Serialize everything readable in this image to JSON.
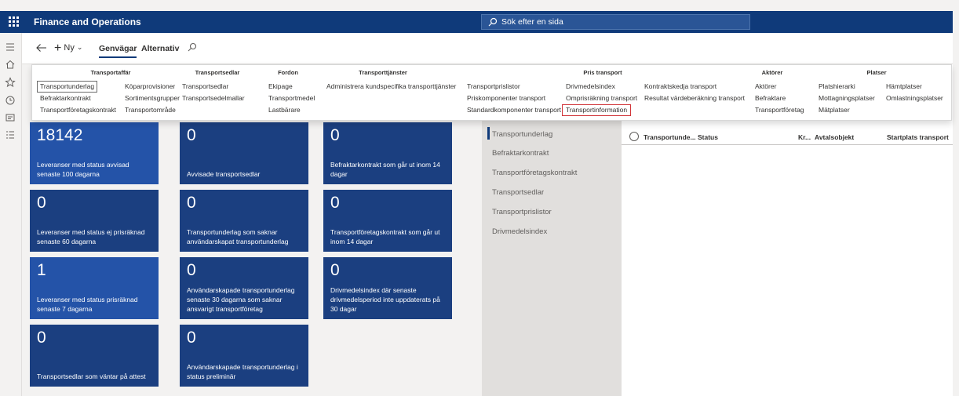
{
  "app": {
    "title": "Finance and Operations"
  },
  "search": {
    "placeholder": "Sök efter en sida"
  },
  "action_pane": {
    "new_label": "Ny",
    "tabs": [
      "Genvägar",
      "Alternativ"
    ]
  },
  "flyout": {
    "groups": {
      "transportaffar": {
        "header": "Transportaffär",
        "col1": [
          "Transportunderlag",
          "Befraktarkontrakt",
          "Transportföretagskontrakt"
        ],
        "col2": [
          "Köparprovisioner",
          "Sortimentsgrupper",
          "Transportområde"
        ]
      },
      "transportsedlar": {
        "header": "Transportsedlar",
        "items": [
          "Transportsedlar",
          "Transportsedelmallar"
        ]
      },
      "fordon": {
        "header": "Fordon",
        "items": [
          "Ekipage",
          "Transportmedel",
          "Lastbärare"
        ]
      },
      "transporttjanster": {
        "header": "Transporttjänster",
        "items": [
          "Administrera kundspecifika transporttjänster"
        ]
      },
      "pris_transport": {
        "header": "Pris transport",
        "col1": [
          "Transportprislistor",
          "Priskomponenter transport",
          "Standardkomponenter transport"
        ],
        "col2": [
          "Drivmedelsindex",
          "Omprisräkning transport",
          "Transportinformation"
        ],
        "col3": [
          "Kontraktskedja transport",
          "Resultat värdeberäkning transport"
        ]
      },
      "aktorer": {
        "header": "Aktörer",
        "items": [
          "Aktörer",
          "Befraktare",
          "Transportföretag"
        ]
      },
      "platser": {
        "header": "Platser",
        "col1": [
          "Platshierarki",
          "Mottagningsplatser",
          "Mätplatser"
        ],
        "col2": [
          "Hämtplatser",
          "Omlastningsplatser"
        ]
      }
    }
  },
  "tiles": [
    {
      "value": "18142",
      "label": "Leveranser med status avvisad senaste 100 dagarna"
    },
    {
      "value": "0",
      "label": "Avvisade transportsedlar"
    },
    {
      "value": "0",
      "label": "Befraktarkontrakt som går ut inom 14 dagar"
    },
    {
      "value": "0",
      "label": "Leveranser med status ej prisräknad senaste 60 dagarna"
    },
    {
      "value": "0",
      "label": "Transportunderlag som saknar användarskapat transportunderlag"
    },
    {
      "value": "0",
      "label": "Transportföretagskontrakt som går ut inom 14 dagar"
    },
    {
      "value": "1",
      "label": "Leveranser med status prisräknad senaste 7 dagarna"
    },
    {
      "value": "0",
      "label": "Användarskapade transportunderlag senaste 30 dagarna som saknar ansvarigt transportföretag"
    },
    {
      "value": "0",
      "label": "Drivmedelsindex där senaste drivmedelsperiod inte uppdaterats på 30 dagar"
    },
    {
      "value": "0",
      "label": "Transportsedlar som väntar på attest"
    },
    {
      "value": "0",
      "label": "Användarskapade transportunderlag i status preliminär"
    }
  ],
  "link_panel": {
    "items": [
      "Transportunderlag",
      "Befraktarkontrakt",
      "Transportföretagskontrakt",
      "Transportsedlar",
      "Transportprislistor",
      "Drivmedelsindex"
    ]
  },
  "grid": {
    "columns": [
      "Transportunde...",
      "Status",
      "Kr...",
      "Avtalsobjekt",
      "Startplats transport"
    ]
  },
  "colors": {
    "navbar": "#0f3a7a",
    "tile_dark": "#1b3f80",
    "tile_bright": "#2453a8",
    "highlight": "#d13438"
  }
}
